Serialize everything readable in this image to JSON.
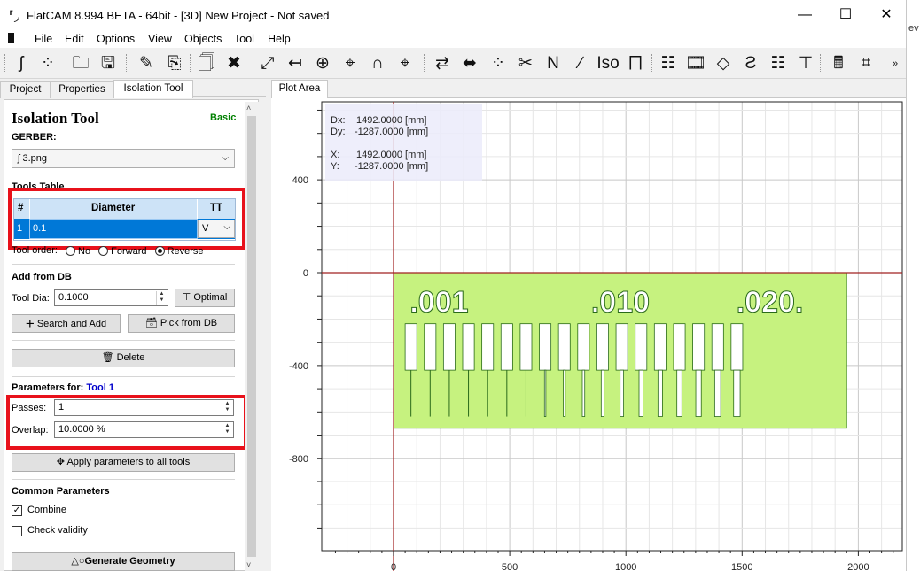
{
  "window": {
    "title": "FlatCAM 8.994 BETA - 64bit - [3D]   New Project - Not saved",
    "minimize": "—",
    "maximize": "☐",
    "close": "✕"
  },
  "right_edge_text": "ev",
  "menu": [
    "File",
    "Edit",
    "Options",
    "View",
    "Objects",
    "Tool",
    "Help"
  ],
  "toolbar_icons": [
    "open-gerber-icon",
    "new-geometry-icon",
    "open-folder-icon",
    "save-icon",
    "edit-icon",
    "copy-icon",
    "new-page-icon",
    "delete-x-icon",
    "resize-icon",
    "distance-icon",
    "target-icon",
    "crosshair-icon",
    "magnet-icon",
    "map-pin-icon",
    "refresh-icon",
    "align-icon",
    "grid-points-icon",
    "cut-icon",
    "ncc-icon",
    "paint-icon",
    "iso-icon",
    "solder-icon",
    "pcb-icon",
    "film-icon",
    "eraser-icon",
    "rules-icon",
    "report-icon",
    "drill-icon",
    "calculator-icon",
    "crop-icon",
    "more-icon"
  ],
  "tabs": {
    "project": "Project",
    "properties": "Properties",
    "isolation": "Isolation Tool"
  },
  "panel": {
    "title": "Isolation Tool",
    "mode": "Basic",
    "gerber_label": "GERBER:",
    "gerber_value": "3.png",
    "tools_table_label": "Tools Table",
    "table": {
      "headers": [
        "#",
        "Diameter",
        "TT"
      ],
      "rows": [
        {
          "num": "1",
          "diameter": "0.1",
          "tt": "V"
        }
      ]
    },
    "tool_order_label": "Tool order:",
    "tool_order_options": [
      "No",
      "Forward",
      "Reverse"
    ],
    "tool_order_selected": "Reverse",
    "add_from_db": "Add from DB",
    "tool_dia_label": "Tool Dia:",
    "tool_dia_value": "0.1000",
    "optimal": "Optimal",
    "search_add": "Search and Add",
    "pick_db": "Pick from DB",
    "delete": "Delete",
    "params_for": "Parameters for:",
    "params_tool": "Tool 1",
    "passes_label": "Passes:",
    "passes_value": "1",
    "overlap_label": "Overlap:",
    "overlap_value": "10.0000 %",
    "apply_all": "Apply parameters to all tools",
    "common_params": "Common Parameters",
    "combine": "Combine",
    "combine_checked": true,
    "check_validity": "Check validity",
    "check_validity_checked": false,
    "generate": "Generate Geometry"
  },
  "plot": {
    "tab_label": "Plot Area",
    "readout": {
      "dx_label": "Dx:",
      "dx_value": "1492.0000 [mm]",
      "dy_label": "Dy:",
      "dy_value": "-1287.0000 [mm]",
      "x_label": "X:",
      "x_value": "1492.0000 [mm]",
      "y_label": "Y:",
      "y_value": "-1287.0000 [mm]"
    },
    "x_ticks": [
      0,
      500,
      1000,
      1500,
      2000
    ],
    "y_ticks": [
      400,
      0,
      -400,
      -800
    ],
    "labels": [
      ".001",
      ".010",
      ".020."
    ],
    "board_color": "#c6f27f",
    "axis_color": "#a02020"
  }
}
